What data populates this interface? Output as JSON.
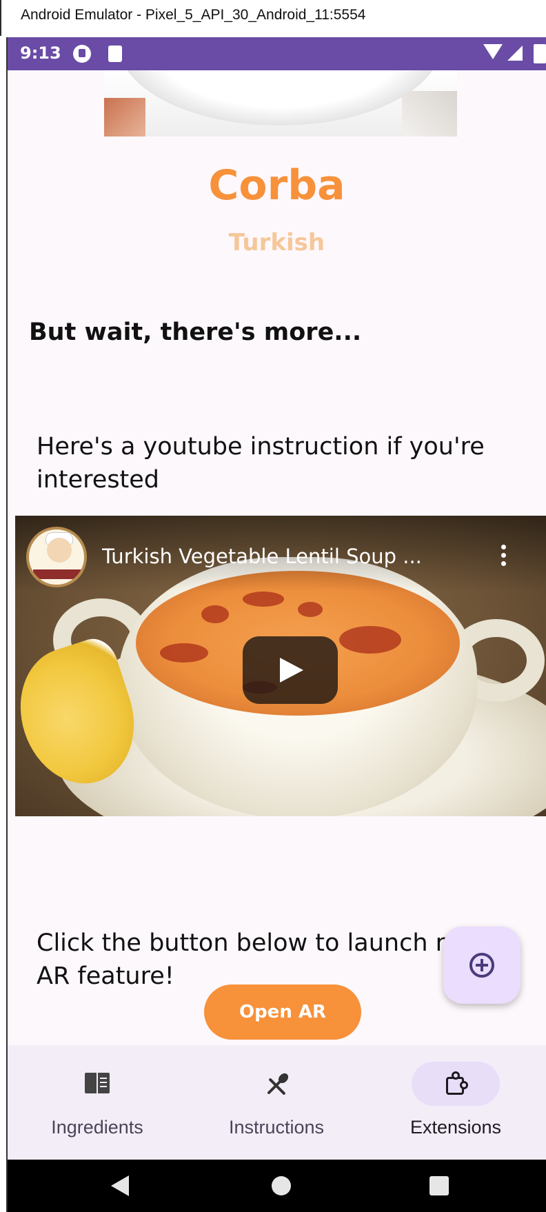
{
  "window": {
    "title": "Android Emulator - Pixel_5_API_30_Android_11:5554"
  },
  "status_bar": {
    "time": "9:13",
    "color": "#6a4ba6"
  },
  "meal": {
    "name": "Corba",
    "area": "Turkish",
    "accent_color": "#f7913a"
  },
  "content": {
    "more_heading": "But wait, there's more...",
    "youtube_intro": "Here's a youtube instruction if you're interested",
    "video_title": "Turkish Vegetable Lentil Soup ...",
    "ar_intro": "Click the button below to launch new AR feature!",
    "open_ar_label": "Open AR"
  },
  "bottom_nav": {
    "items": [
      {
        "label": "Ingredients",
        "icon": "book-icon",
        "active": false
      },
      {
        "label": "Instructions",
        "icon": "utensils-icon",
        "active": false
      },
      {
        "label": "Extensions",
        "icon": "puzzle-icon",
        "active": true
      }
    ]
  },
  "icons": {
    "fab": "add-circle-icon",
    "video_menu": "more-vert-icon",
    "play": "play-icon"
  }
}
